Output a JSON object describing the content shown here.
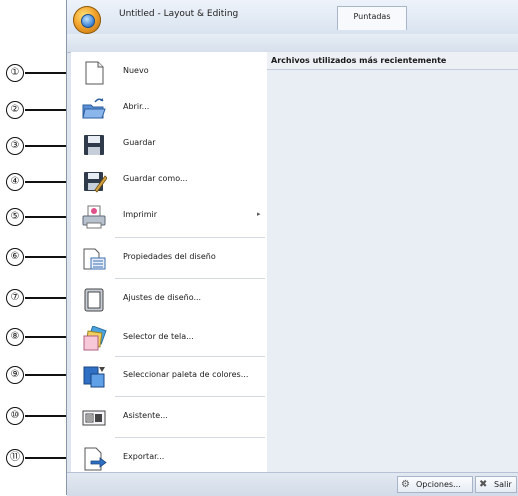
{
  "window": {
    "title": "Untitled - Layout & Editing",
    "tab_label": "Puntadas"
  },
  "menu": {
    "items": [
      {
        "label": "Nuevo",
        "icon": "new-document-icon",
        "number": "①"
      },
      {
        "label": "Abrir...",
        "icon": "open-folder-icon",
        "number": "②"
      },
      {
        "label": "Guardar",
        "icon": "save-disk-icon",
        "number": "③"
      },
      {
        "label": "Guardar como...",
        "icon": "save-as-icon",
        "number": "④"
      },
      {
        "label": "Imprimir",
        "icon": "printer-icon",
        "number": "⑤",
        "has_submenu": true
      },
      {
        "label": "Propiedades del diseño",
        "icon": "design-properties-icon",
        "number": "⑥"
      },
      {
        "label": "Ajustes de diseño...",
        "icon": "design-settings-icon",
        "number": "⑦"
      },
      {
        "label": "Selector de tela...",
        "icon": "fabric-selector-icon",
        "number": "⑧"
      },
      {
        "label": "Seleccionar paleta de colores...",
        "icon": "color-palette-icon",
        "number": "⑨"
      },
      {
        "label": "Asistente...",
        "icon": "wizard-icon",
        "number": "⑩"
      },
      {
        "label": "Exportar...",
        "icon": "export-icon",
        "number": "⑪"
      }
    ]
  },
  "recent": {
    "header": "Archivos utilizados más recientemente"
  },
  "bottom": {
    "options_label": "Opciones...",
    "exit_label": "Salir"
  },
  "colors": {
    "accent_blue": "#3a7fd0",
    "orb_orange": "#f2a22a",
    "panel_bg": "#e9eef5"
  }
}
